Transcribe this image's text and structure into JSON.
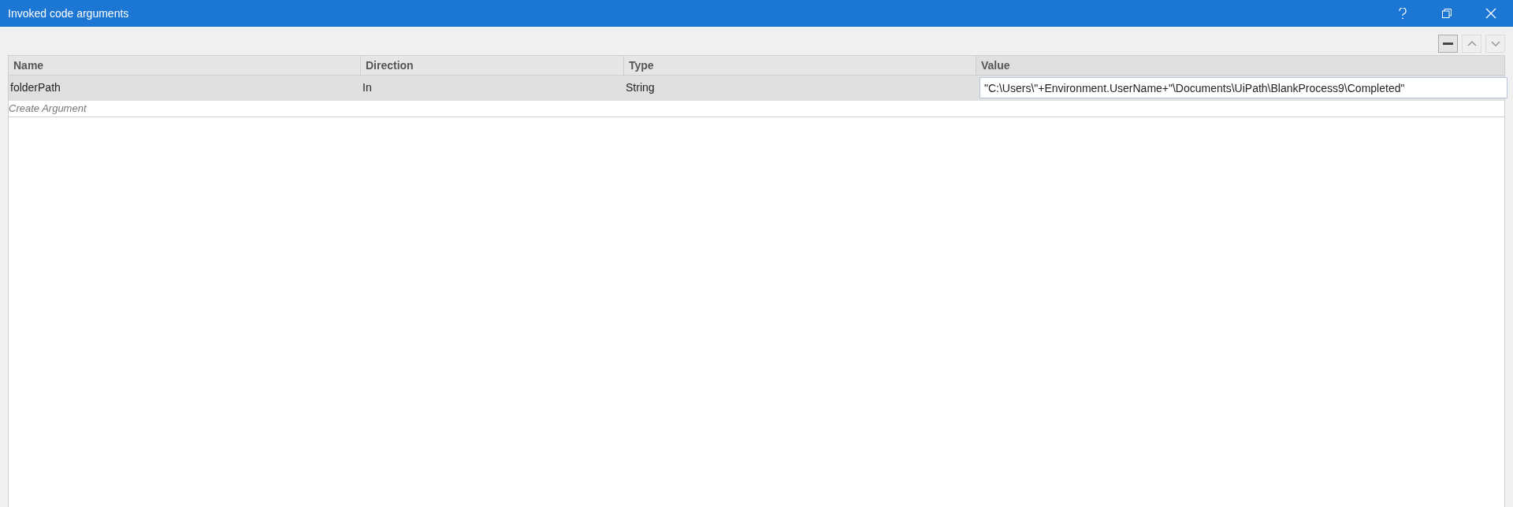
{
  "window": {
    "title": "Invoked code arguments"
  },
  "toolbar": [
    {
      "kind": "remove",
      "disabled": false
    },
    {
      "kind": "up",
      "disabled": true
    },
    {
      "kind": "down",
      "disabled": true
    }
  ],
  "table": {
    "columns": [
      "Name",
      "Direction",
      "Type",
      "Value"
    ],
    "rows": [
      {
        "name": "folderPath",
        "direction": "In",
        "type": "String",
        "value": "\"C:\\Users\\\"+Environment.UserName+\"\\Documents\\UiPath\\BlankProcess9\\Completed\"",
        "selected": true
      }
    ],
    "create_placeholder": "Create Argument"
  }
}
